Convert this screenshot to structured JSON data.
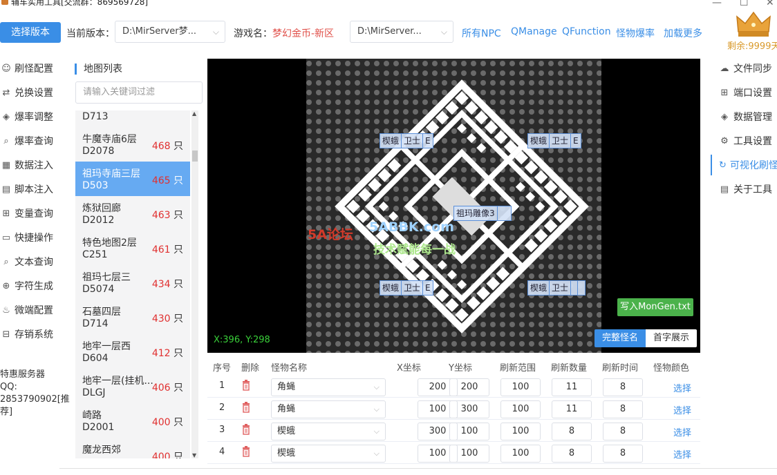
{
  "window": {
    "title": "辅车实用工具[交流群：869569728]"
  },
  "toolbar": {
    "select_version": "选择版本",
    "current_version_label": "当前版本：",
    "current_version_value": "D:\\MirServer梦...",
    "game_name_label": "游戏名：",
    "game_name_value": "梦幻金币-新区",
    "server_path_value": "D:\\MirServer...",
    "links": [
      "所有NPC",
      "QManage",
      "QFunction",
      "怪物爆率",
      "加载更多"
    ],
    "remaining": "剩余:9999天"
  },
  "left_nav": {
    "items": [
      {
        "icon": "monster-icon",
        "label": "刷怪配置"
      },
      {
        "icon": "exchange-icon",
        "label": "兑换设置"
      },
      {
        "icon": "cube-icon",
        "label": "爆率调整"
      },
      {
        "icon": "search-icon",
        "label": "爆率查询"
      },
      {
        "icon": "inject-icon",
        "label": "数据注入"
      },
      {
        "icon": "script-icon",
        "label": "脚本注入"
      },
      {
        "icon": "variable-icon",
        "label": "变量查询"
      },
      {
        "icon": "folder-icon",
        "label": "快捷操作"
      },
      {
        "icon": "text-search-icon",
        "label": "文本查询"
      },
      {
        "icon": "lock-icon",
        "label": "字符生成"
      },
      {
        "icon": "micro-icon",
        "label": "微端配置"
      },
      {
        "icon": "store-icon",
        "label": "存销系统"
      }
    ],
    "promo_lines": [
      "特惠服务器",
      "QQ:",
      "2853790902[推",
      "荐]"
    ]
  },
  "map_list": {
    "title": "地图列表",
    "filter_placeholder": "请输入关键词过滤",
    "items": [
      {
        "name": "",
        "code": "D713",
        "count": "",
        "unit": ""
      },
      {
        "name": "牛魔寺庙6层",
        "code": "D2078",
        "count": "468",
        "unit": " 只"
      },
      {
        "name": "祖玛寺庙三层",
        "code": "D503",
        "count": "465",
        "unit": " 只",
        "selected": true
      },
      {
        "name": "炼狱回廊",
        "code": "D2012",
        "count": "463",
        "unit": " 只"
      },
      {
        "name": "特色地图2层",
        "code": "C251",
        "count": "461",
        "unit": " 只"
      },
      {
        "name": "祖玛七层三",
        "code": "D5074",
        "count": "434",
        "unit": " 只"
      },
      {
        "name": "石墓四层",
        "code": "D714",
        "count": "430",
        "unit": " 只"
      },
      {
        "name": "地牢一层西",
        "code": "D604",
        "count": "412",
        "unit": " 只"
      },
      {
        "name": "地牢一层(挂机...",
        "code": "DLGJ",
        "count": "406",
        "unit": " 只"
      },
      {
        "name": "崎路",
        "code": "D2001",
        "count": "400",
        "unit": " 只"
      },
      {
        "name": "魔龙西郊",
        "code": "",
        "count": "400",
        "unit": " 只"
      }
    ]
  },
  "map_view": {
    "coords": "X:396, Y:298",
    "write_button": "写入MonGen.txt",
    "mode_full": "完整怪名",
    "mode_first": "首字展示",
    "labels": [
      {
        "parts": [
          "楔蛾",
          "卫士",
          "E"
        ]
      },
      {
        "parts": [
          "楔蛾",
          "卫士",
          "E"
        ]
      },
      {
        "parts": [
          "祖玛雕像3",
          ""
        ]
      },
      {
        "parts": [
          "楔蛾",
          "卫士",
          "E"
        ]
      },
      {
        "parts": [
          "楔蛾",
          "卫士",
          "",
          ""
        ]
      }
    ],
    "watermark_site": "5ABBK.com",
    "watermark_slogan": "技术赋能每一战",
    "watermark_logo": "5A论坛"
  },
  "table": {
    "headers": [
      "序号",
      "删除",
      "怪物名称",
      "X坐标",
      "Y坐标",
      "刷新范围",
      "刷新数量",
      "刷新时间",
      "怪物颜色"
    ],
    "rows": [
      {
        "idx": "1",
        "name": "角蝇",
        "x": "200",
        "y": "200",
        "range": "100",
        "qty": "11",
        "time": "8",
        "color": "选择"
      },
      {
        "idx": "2",
        "name": "角蝇",
        "x": "100",
        "y": "300",
        "range": "100",
        "qty": "11",
        "time": "8",
        "color": "选择"
      },
      {
        "idx": "3",
        "name": "楔蛾",
        "x": "300",
        "y": "100",
        "range": "100",
        "qty": "8",
        "time": "8",
        "color": "选择"
      },
      {
        "idx": "4",
        "name": "楔蛾",
        "x": "100",
        "y": "100",
        "range": "100",
        "qty": "8",
        "time": "8",
        "color": "选择"
      }
    ]
  },
  "right_nav": {
    "items": [
      {
        "icon": "cloud-sync-icon",
        "label": "文件同步"
      },
      {
        "icon": "port-icon",
        "label": "端口设置"
      },
      {
        "icon": "database-icon",
        "label": "数据管理"
      },
      {
        "icon": "gear-icon",
        "label": "工具设置"
      },
      {
        "icon": "refresh-icon",
        "label": "可视化刷怪",
        "active": true
      },
      {
        "icon": "info-icon",
        "label": "关于工具"
      }
    ]
  },
  "colors": {
    "accent": "#3a8ee6",
    "count_red": "#e03030",
    "selected_row": "#66aaf2",
    "write_button_green": "#4bb24b",
    "coords_green": "#3ad13a"
  }
}
